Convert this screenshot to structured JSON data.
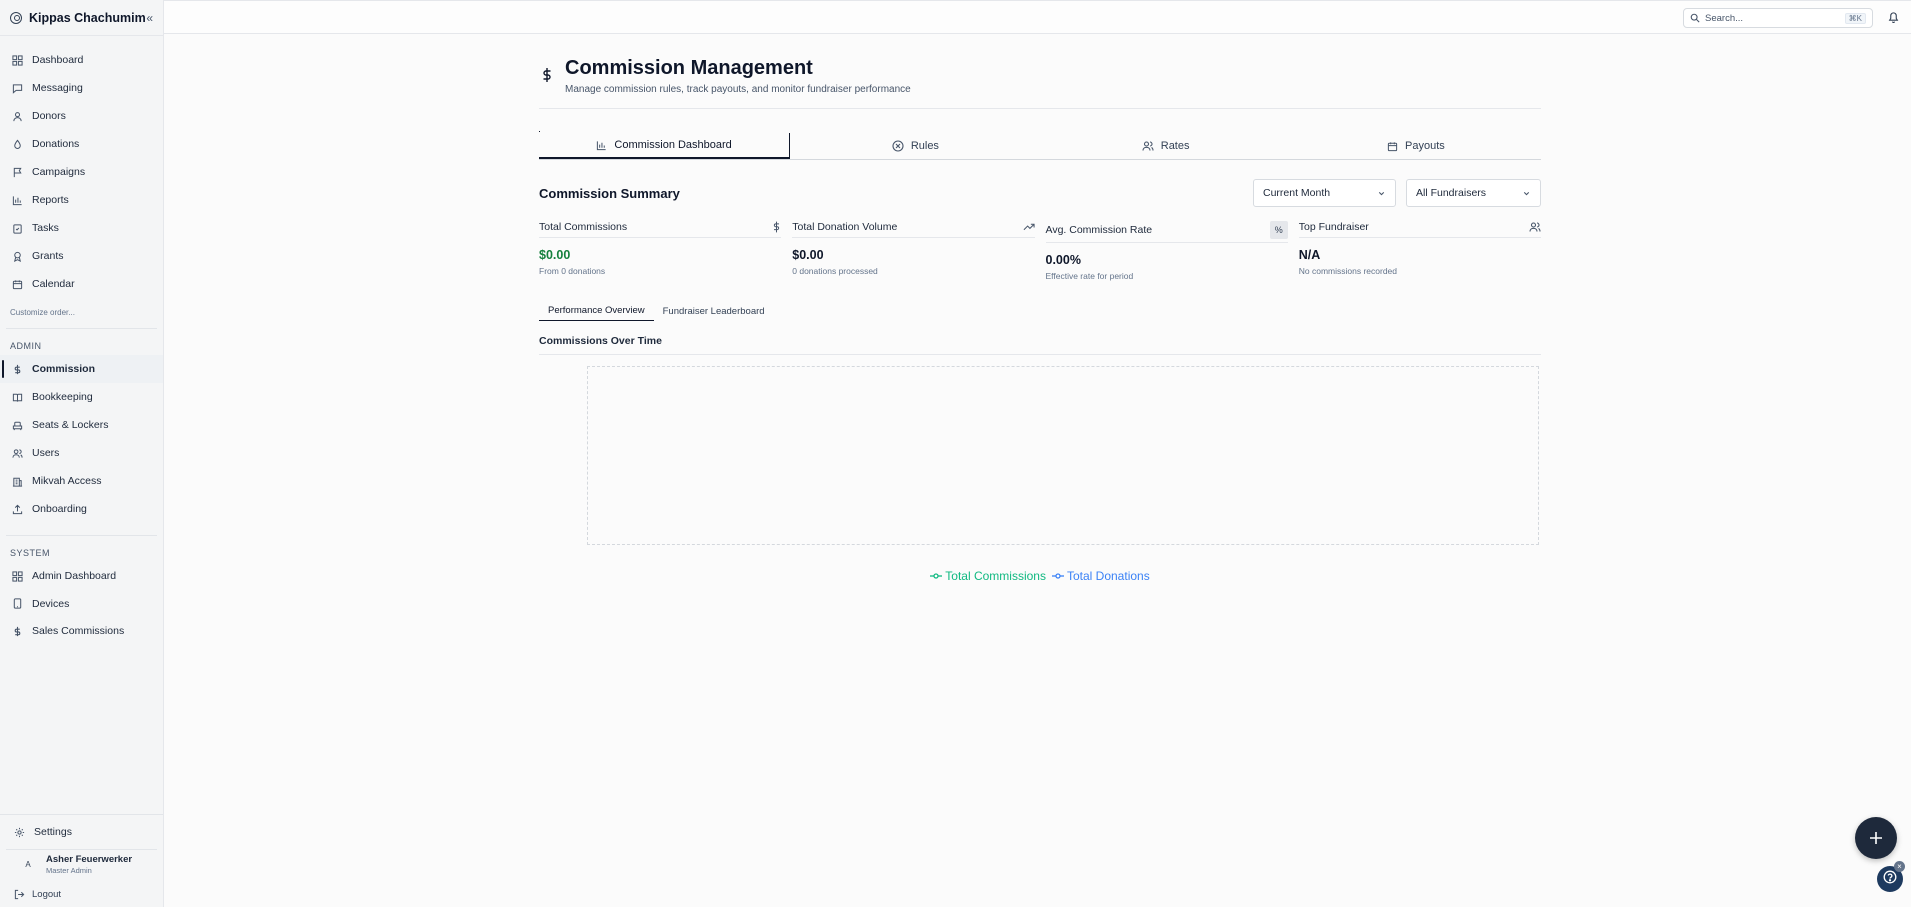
{
  "brand": {
    "name": "Kippas Chachumim",
    "collapse_icon": "chevrons-left-icon"
  },
  "sidebar": {
    "main_items": [
      {
        "label": "Dashboard",
        "icon": "grid-icon"
      },
      {
        "label": "Messaging",
        "icon": "message-icon"
      },
      {
        "label": "Donors",
        "icon": "user-icon"
      },
      {
        "label": "Donations",
        "icon": "droplet-icon"
      },
      {
        "label": "Campaigns",
        "icon": "flag-icon"
      },
      {
        "label": "Reports",
        "icon": "bar-chart-icon"
      },
      {
        "label": "Tasks",
        "icon": "clipboard-icon"
      },
      {
        "label": "Grants",
        "icon": "award-icon"
      },
      {
        "label": "Calendar",
        "icon": "calendar-icon"
      }
    ],
    "customize_label": "Customize order...",
    "admin_label": "ADMIN",
    "admin_items": [
      {
        "label": "Commission",
        "icon": "dollar-icon",
        "active": true
      },
      {
        "label": "Bookkeeping",
        "icon": "book-icon"
      },
      {
        "label": "Seats & Lockers",
        "icon": "armchair-icon"
      },
      {
        "label": "Users",
        "icon": "users-icon"
      },
      {
        "label": "Mikvah Access",
        "icon": "building-icon"
      },
      {
        "label": "Onboarding",
        "icon": "upload-icon"
      }
    ],
    "system_label": "SYSTEM",
    "system_items": [
      {
        "label": "Admin Dashboard",
        "icon": "grid-icon"
      },
      {
        "label": "Devices",
        "icon": "tablet-icon"
      },
      {
        "label": "Sales Commissions",
        "icon": "dollar-icon"
      }
    ],
    "settings_label": "Settings",
    "user": {
      "initial": "A",
      "name": "Asher Feuerwerker",
      "role": "Master Admin"
    },
    "logout_label": "Logout"
  },
  "topbar": {
    "search_placeholder": "Search...",
    "search_shortcut": "⌘K"
  },
  "page": {
    "title": "Commission Management",
    "subtitle": "Manage commission rules, track payouts, and monitor fundraiser performance"
  },
  "tabs": [
    {
      "label": "Commission Dashboard",
      "icon": "bar-chart-icon",
      "active": true
    },
    {
      "label": "Rules",
      "icon": "x-circle-icon"
    },
    {
      "label": "Rates",
      "icon": "users-icon"
    },
    {
      "label": "Payouts",
      "icon": "calendar-icon"
    }
  ],
  "summary": {
    "title": "Commission Summary",
    "period_select": "Current Month",
    "fundraiser_select": "All Fundraisers"
  },
  "stats": {
    "total_commissions": {
      "label": "Total Commissions",
      "value": "$0.00",
      "note": "From 0 donations"
    },
    "donation_volume": {
      "label": "Total Donation Volume",
      "value": "$0.00",
      "note": "0 donations processed"
    },
    "avg_rate": {
      "label": "Avg. Commission Rate",
      "badge": "%",
      "value": "0.00%",
      "note": "Effective rate for period"
    },
    "top_fundraiser": {
      "label": "Top Fundraiser",
      "value": "N/A",
      "note": "No commissions recorded"
    }
  },
  "subtabs": [
    "Performance Overview",
    "Fundraiser Leaderboard"
  ],
  "chart": {
    "title": "Commissions Over Time",
    "legend": [
      {
        "name": "Total Commissions",
        "color": "#10b981"
      },
      {
        "name": "Total Donations",
        "color": "#3b82f6"
      }
    ]
  },
  "colors": {
    "accent_green": "#15803d",
    "primary": "#0f172a"
  }
}
